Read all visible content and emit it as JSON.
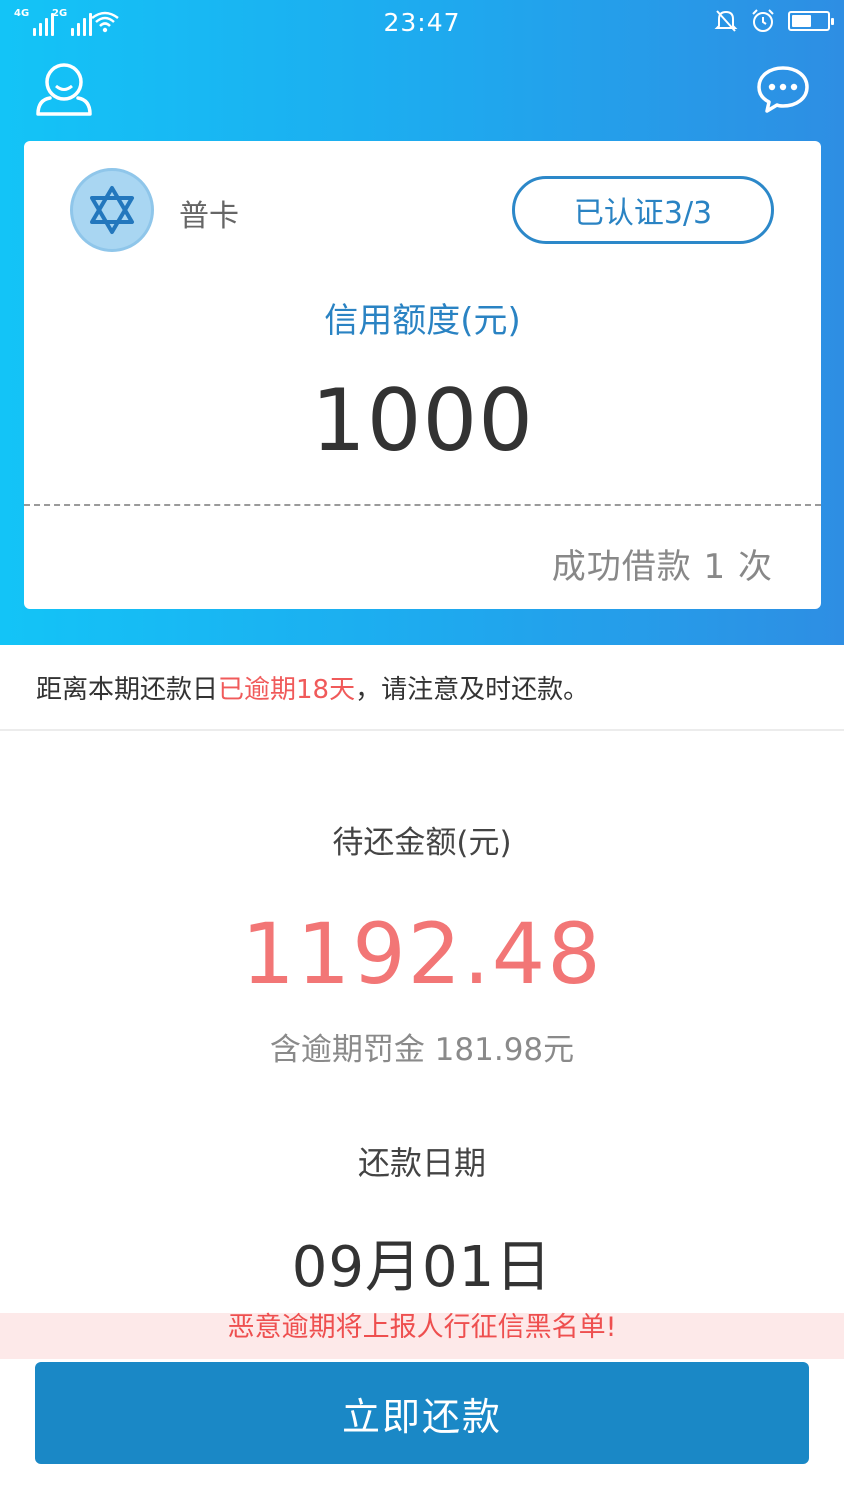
{
  "status_bar": {
    "net1": "4G",
    "net2": "2G",
    "time": "23:47",
    "battery_level": 0.55
  },
  "card": {
    "level_name": "普卡",
    "cert_button": "已认证3/3",
    "credit_label": "信用额度(元)",
    "credit_value": "1000",
    "loan_count": "成功借款 1 次"
  },
  "notice": {
    "prefix": "距离本期还款日",
    "overdue": "已逾期18天",
    "suffix": "，请注意及时还款。"
  },
  "repayment": {
    "amount_label": "待还金额(元)",
    "amount": "1192.48",
    "penalty": "含逾期罚金 181.98元",
    "date_label": "还款日期",
    "date": "09月01日",
    "warning": "恶意逾期将上报人行征信黑名单!",
    "button": "立即还款"
  },
  "icons": {
    "profile": "user-icon",
    "message": "chat-icon",
    "badge": "star-of-david-icon"
  },
  "colors": {
    "header_gradient_start": "#13c4f7",
    "header_gradient_end": "#2e8ee3",
    "accent": "#2a83c3",
    "overdue_red": "#f05a5a",
    "amount_red": "#f27676",
    "button": "#1a88c6"
  }
}
